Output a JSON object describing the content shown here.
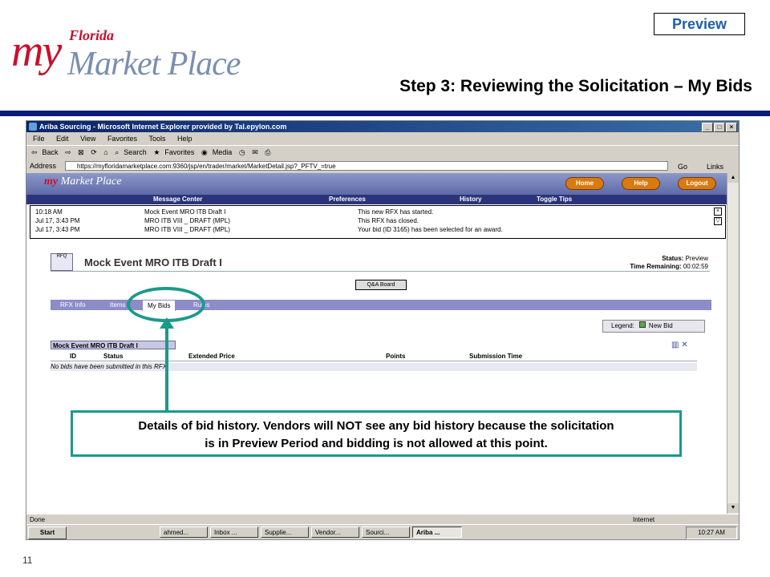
{
  "slide": {
    "preview_tag": "Preview",
    "logo_my": "my",
    "logo_florida": "Florida",
    "logo_marketplace": "Market Place",
    "title": "Step 3: Reviewing the Solicitation – My Bids",
    "page_number": "11"
  },
  "browser": {
    "window_title": "Ariba Sourcing - Microsoft Internet Explorer provided by Tal.epylon.com",
    "menu": [
      "File",
      "Edit",
      "View",
      "Favorites",
      "Tools",
      "Help"
    ],
    "toolbar": [
      "Back",
      "Search",
      "Favorites",
      "Media"
    ],
    "address_label": "Address",
    "address_url": "https://myfloridamarketplace.com:9360/jsp/en/trader/market/MarketDetail.jsp?_PFTV_=true",
    "go_label": "Go",
    "links_label": "Links",
    "status_done": "Done",
    "status_zone": "Internet"
  },
  "app": {
    "buttons": {
      "home": "Home",
      "help": "Help",
      "logout": "Logout"
    },
    "nav": [
      "Message Center",
      "Preferences",
      "History",
      "Toggle Tips"
    ],
    "messages": [
      {
        "time": "10:18 AM",
        "event": "Mock Event MRO ITB Draft I",
        "text": "This new RFX has started."
      },
      {
        "time": "Jul 17, 3:43 PM",
        "event": "MRO ITB VIII _ DRAFT (MPL)",
        "text": "This RFX has closed."
      },
      {
        "time": "Jul 17, 3:43 PM",
        "event": "MRO ITB VIII _ DRAFT (MPL)",
        "text": "Your bid (ID 3165) has been selected for an award."
      }
    ],
    "rfq_icon_label": "RFQ",
    "event_title": "Mock Event MRO ITB Draft I",
    "status_label": "Status:",
    "status_value": "Preview",
    "time_label": "Time Remaining:",
    "time_value": "00:02:59",
    "qa_button": "Q&A Board",
    "tabs": [
      "RFX Info",
      "Items",
      "My Bids",
      "Rules"
    ],
    "legend_label": "Legend:",
    "legend_item": "New Bid",
    "bid_section_title": "Mock Event MRO ITB Draft I",
    "columns": [
      "ID",
      "Status",
      "Extended Price",
      "Points",
      "Submission Time"
    ],
    "empty_message": "No bids have been submitted in this RFX."
  },
  "taskbar": {
    "start": "Start",
    "items": [
      "ahmed...",
      "Inbox ...",
      "Supplie...",
      "Vendor...",
      "Sourci...",
      "Ariba ..."
    ],
    "clock": "10:27 AM"
  },
  "callout": {
    "line1": "Details of bid history.  Vendors will NOT see any bid history because the solicitation",
    "line2": "is in Preview Period and bidding is not allowed at this point."
  },
  "colors": {
    "accent": "#1a9a8a",
    "rule": "#0c1a78",
    "preview": "#1f5fa8"
  }
}
